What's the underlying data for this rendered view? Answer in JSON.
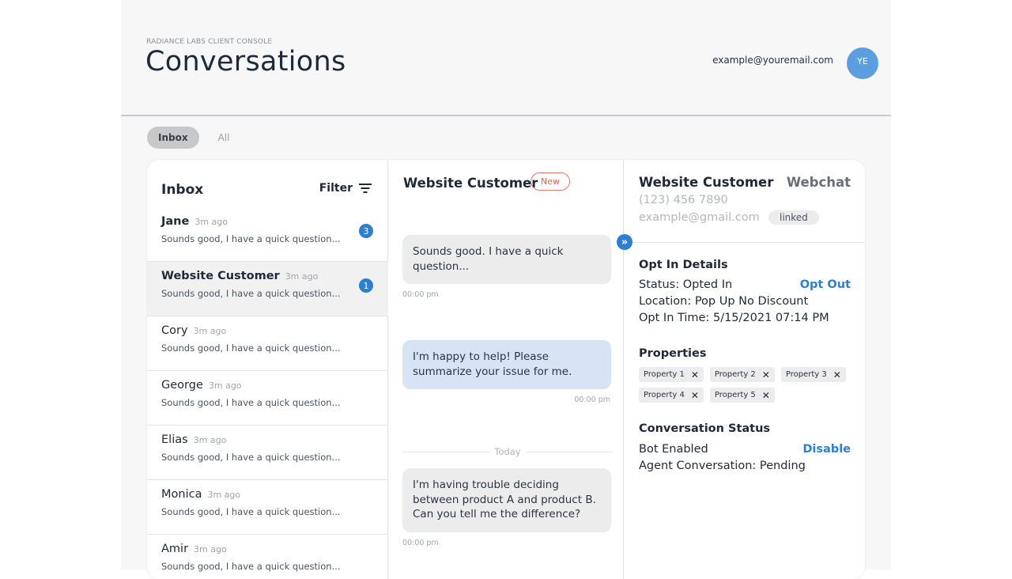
{
  "header": {
    "eyebrow": "RADIANCE LABS CLIENT CONSOLE",
    "title": "Conversations",
    "user_email": "example@youremail.com",
    "avatar_initials": "YE"
  },
  "tabs": [
    {
      "label": "Inbox",
      "active": true
    },
    {
      "label": "All",
      "active": false
    }
  ],
  "inbox": {
    "title": "Inbox",
    "filter_label": "Filter",
    "conversations": [
      {
        "name": "Jane",
        "time": "3m ago",
        "preview": "Sounds good, I have a quick question...",
        "unread": "3"
      },
      {
        "name": "Website Customer",
        "time": "3m ago",
        "preview": "Sounds good, I have a quick question...",
        "unread": "1"
      },
      {
        "name": "Cory",
        "time": "3m ago",
        "preview": "Sounds good, I have a quick question..."
      },
      {
        "name": "George",
        "time": "3m ago",
        "preview": "Sounds good, I have a quick question..."
      },
      {
        "name": "Elias",
        "time": "3m ago",
        "preview": "Sounds good, I have a quick question..."
      },
      {
        "name": "Monica",
        "time": "3m ago",
        "preview": "Sounds good, I have a quick question..."
      },
      {
        "name": "Amir",
        "time": "3m ago",
        "preview": "Sounds good, I have a quick question..."
      }
    ]
  },
  "chat": {
    "title": "Website Customer",
    "status_pill": "New",
    "messages": [
      {
        "text": "Sounds good. I have a quick question...",
        "time": "00:00 pm"
      },
      {
        "text": "I'm happy to help! Please summarize your issue for me.",
        "time": "00:00 pm"
      },
      {
        "text": "I'm having trouble deciding between product A and product B. Can you tell me the difference?",
        "time": "00:00 pm"
      }
    ],
    "divider_label": "Today"
  },
  "details": {
    "name": "Website Customer",
    "channel": "Webchat",
    "phone": "(123) 456 7890",
    "email": "example@gmail.com",
    "linked_label": "linked",
    "opt_in": {
      "title": "Opt In Details",
      "status": "Status: Opted In",
      "action": "Opt Out",
      "location": "Location: Pop Up No Discount",
      "time": "Opt In Time: 5/15/2021 07:14 PM"
    },
    "properties": {
      "title": "Properties",
      "items": [
        "Property 1",
        "Property 2",
        "Property 3",
        "Property 4",
        "Property 5"
      ]
    },
    "conversation_status": {
      "title": "Conversation Status",
      "bot": "Bot Enabled",
      "action": "Disable",
      "agent": "Agent Conversation: Pending"
    }
  },
  "colors": {
    "accent": "#2d7fd1",
    "avatar": "#5b9fe0",
    "new_pill": "#d9654f",
    "agent_bubble": "#d6e4f5",
    "customer_bubble": "#ececed"
  },
  "icons": {
    "filter": "filter-lines-icon",
    "expand": "double-chevron-right-icon",
    "remove": "close-icon"
  }
}
